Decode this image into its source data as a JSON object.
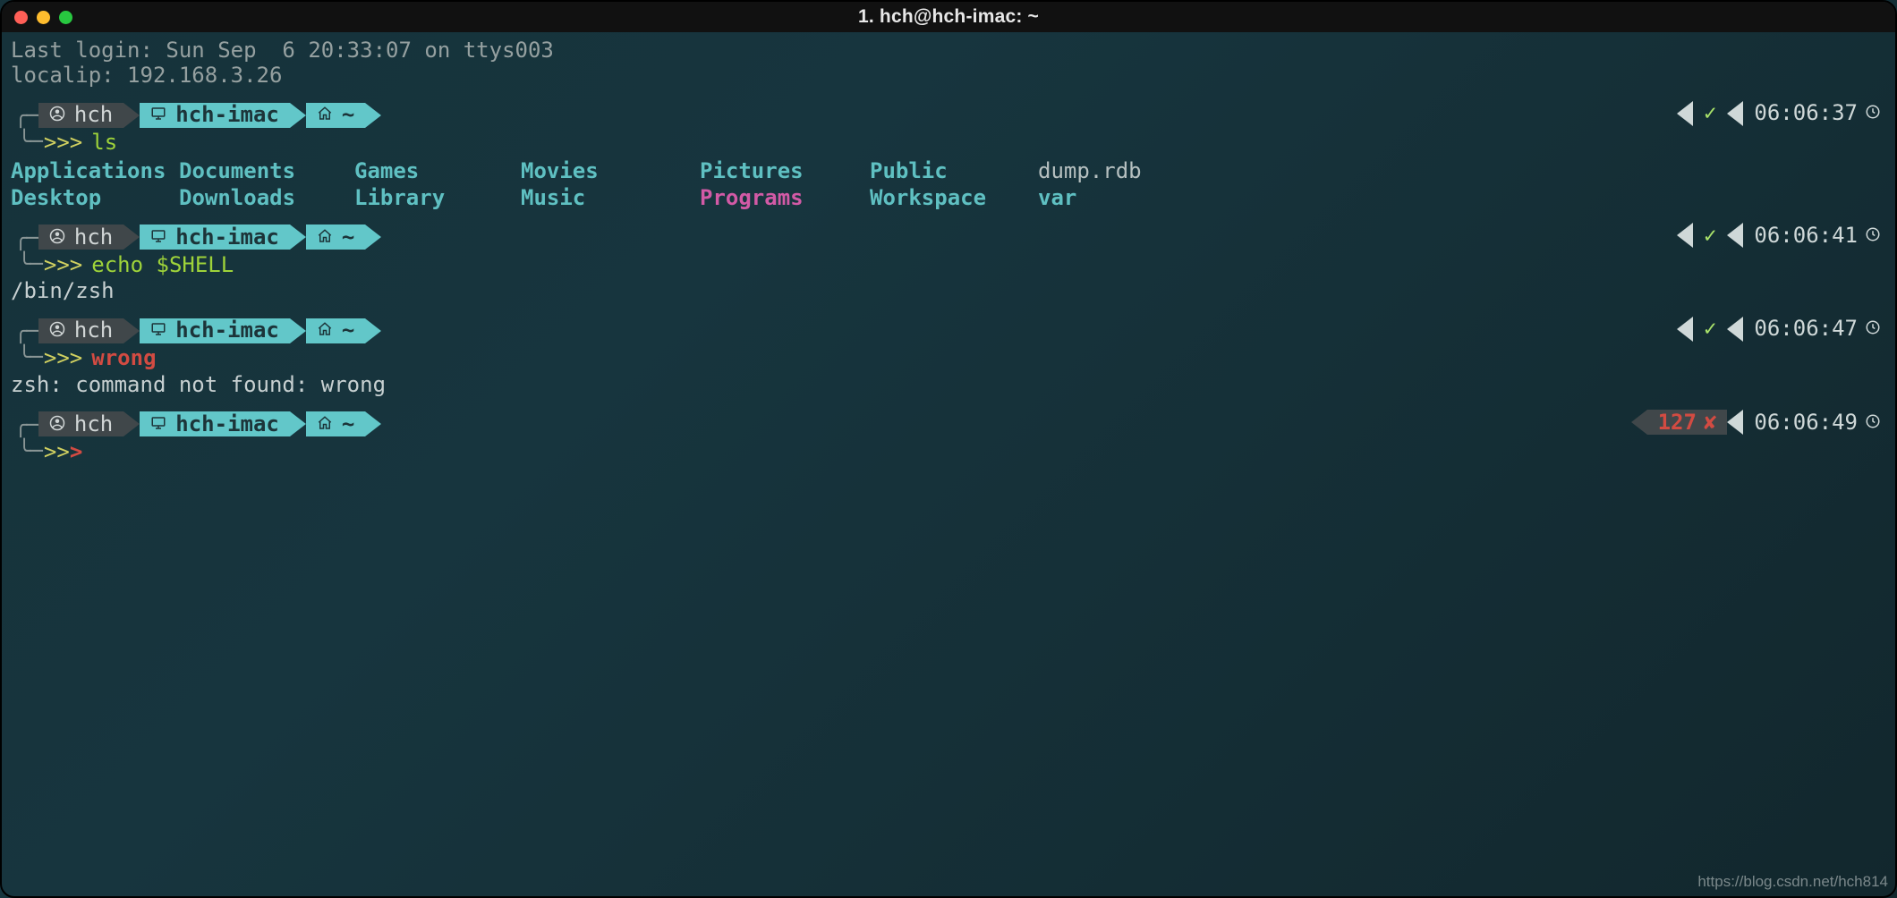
{
  "window": {
    "title": "1. hch@hch-imac: ~"
  },
  "motd": {
    "last_login": "Last login: Sun Sep  6 20:33:07 on ttys003",
    "localip": "localip: 192.168.3.26"
  },
  "prompt_segments": {
    "user": "hch",
    "host": "hch-imac",
    "path": "~"
  },
  "blocks": [
    {
      "time": "06:06:37",
      "status": "ok",
      "command": "ls",
      "cmd_class": "cmd-ok",
      "ls_rows": [
        [
          {
            "t": "Applications",
            "cls": "c0"
          },
          {
            "t": "Documents",
            "cls": "c1"
          },
          {
            "t": "Games",
            "cls": "c2"
          },
          {
            "t": "Movies",
            "cls": "c3"
          },
          {
            "t": "Pictures",
            "cls": "c4"
          },
          {
            "t": "Public",
            "cls": "c5"
          },
          {
            "t": "dump.rdb",
            "cls": "c6 file"
          }
        ],
        [
          {
            "t": "Desktop",
            "cls": "c0"
          },
          {
            "t": "Downloads",
            "cls": "c1"
          },
          {
            "t": "Library",
            "cls": "c2"
          },
          {
            "t": "Music",
            "cls": "c3"
          },
          {
            "t": "Programs",
            "cls": "c4 sym"
          },
          {
            "t": "Workspace",
            "cls": "c5"
          },
          {
            "t": "var",
            "cls": "c6"
          }
        ]
      ]
    },
    {
      "time": "06:06:41",
      "status": "ok",
      "command": "echo $SHELL",
      "cmd_class": "cmd-ok",
      "output": "/bin/zsh"
    },
    {
      "time": "06:06:47",
      "status": "ok",
      "command": "wrong",
      "cmd_class": "cmd-bad",
      "output": "zsh: command not found: wrong"
    },
    {
      "time": "06:06:49",
      "status": "fail",
      "exit_code": "127",
      "command": "",
      "cmd_class": "cmd-bad",
      "caret_bad": true
    }
  ],
  "glyphs": {
    "check": "✓",
    "cross": "✘",
    "chevrons": ">>>",
    "corner_top": "╭─",
    "corner_bot": "╰─"
  },
  "watermark": "https://blog.csdn.net/hch814"
}
